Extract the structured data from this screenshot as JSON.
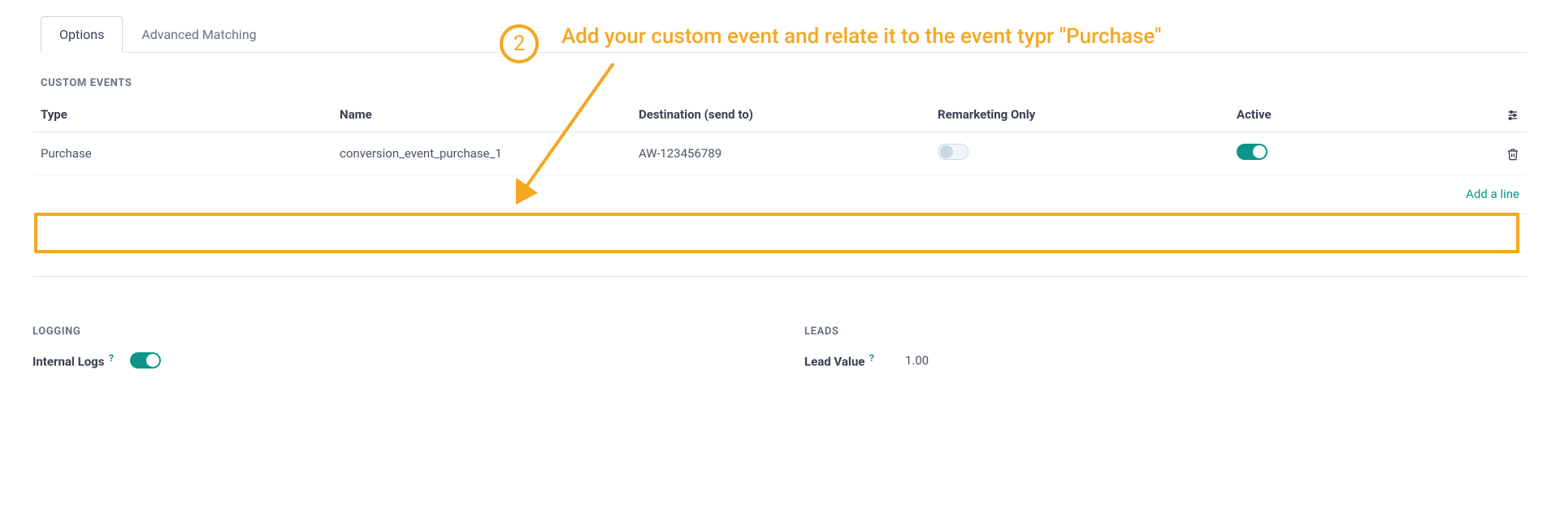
{
  "annotation": {
    "step_number": "2",
    "text": "Add your custom event and relate it to the event typr \"Purchase\""
  },
  "tabs": {
    "options_label": "Options",
    "advanced_label": "Advanced Matching"
  },
  "custom_events": {
    "section_title": "CUSTOM EVENTS",
    "headers": {
      "type": "Type",
      "name": "Name",
      "destination": "Destination (send to)",
      "remarketing": "Remarketing Only",
      "active": "Active"
    },
    "row": {
      "type": "Purchase",
      "name": "conversion_event_purchase_1",
      "destination": "AW-123456789"
    },
    "add_line_label": "Add a line"
  },
  "logging": {
    "section_title": "LOGGING",
    "internal_logs_label": "Internal Logs"
  },
  "leads": {
    "section_title": "LEADS",
    "lead_value_label": "Lead Value",
    "lead_value": "1.00"
  }
}
